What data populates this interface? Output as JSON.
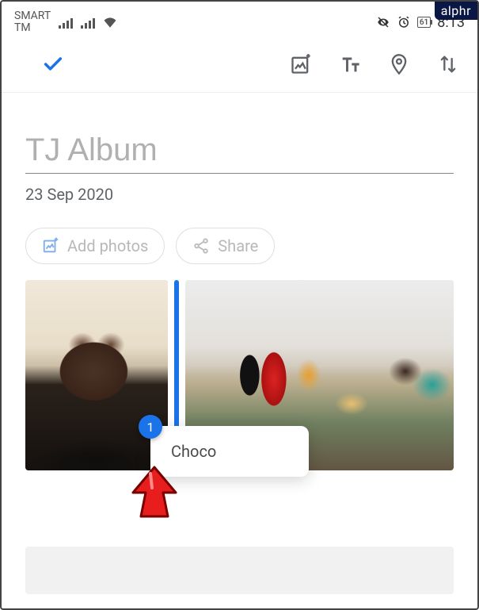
{
  "watermark": "alphr",
  "status": {
    "carrier_line1": "SMART",
    "carrier_line2": "TM",
    "battery_pct": "61",
    "clock": "8:13"
  },
  "toolbar": {
    "confirm_icon": "check-icon",
    "add_media_icon": "add-media-icon",
    "text_icon": "text-format-icon",
    "location_icon": "location-pin-icon",
    "sort_icon": "sort-arrows-icon"
  },
  "album": {
    "title_value": "TJ Album",
    "date": "23 Sep 2020"
  },
  "actions": {
    "add_photos_label": "Add photos",
    "share_label": "Share"
  },
  "grid": {
    "photo1_alt": "Brown dog resting on black chair",
    "photo2_alt": "Table with party food, soda bottles, cake, and dog"
  },
  "suggestion": {
    "count": "1",
    "text": "Choco"
  }
}
